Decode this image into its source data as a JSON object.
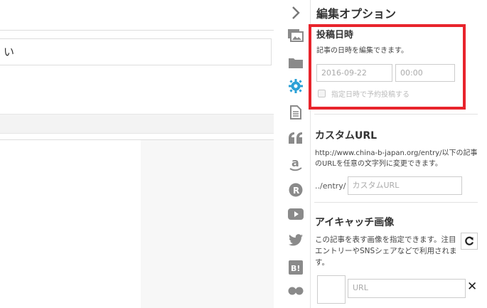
{
  "editor": {
    "title_value": "い"
  },
  "iconbar": {
    "icons": [
      "chevron-right-icon",
      "images-icon",
      "folder-icon",
      "gear-icon",
      "document-icon",
      "quote-icon",
      "amazon-icon",
      "rakuten-icon",
      "youtube-icon",
      "twitter-icon",
      "hatena-bookmark-icon",
      "flickr-icon"
    ],
    "hatena_text": "B!",
    "rakuten_text": "R",
    "amazon_text": "a",
    "quote_text": "❝"
  },
  "panel": {
    "title": "編集オプション",
    "post_date": {
      "title": "投稿日時",
      "description": "記事の日時を編集できます。",
      "date_placeholder": "2016-09-22",
      "time_placeholder": "00:00",
      "schedule_label": "指定日時で予約投稿する"
    },
    "custom_url": {
      "title": "カスタムURL",
      "description": "http://www.china-b-japan.org/entry/以下の記事のURLを任意の文字列に変更できます。",
      "prefix": "../entry/",
      "placeholder": "カスタムURL"
    },
    "eyecatch": {
      "title": "アイキャッチ画像",
      "description": "この記事を表す画像を指定できます。注目エントリーやSNSシェアなどで利用されます。",
      "refresh_icon": "C",
      "url_placeholder": "URL",
      "close_icon": "✕"
    }
  },
  "colors": {
    "highlight": "#e8242c",
    "icon": "#8a8a8a",
    "gear_active": "#2aa0d6"
  }
}
